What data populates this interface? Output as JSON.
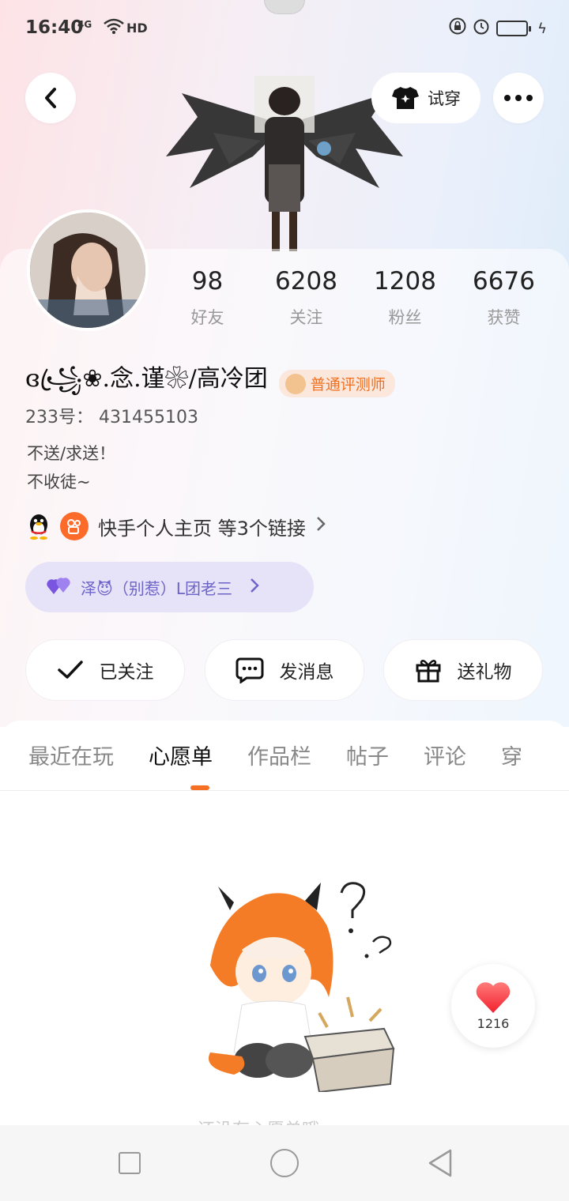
{
  "status_bar": {
    "time": "16:40",
    "network": "4G",
    "hd": "HD"
  },
  "header": {
    "try_on_label": "试穿"
  },
  "profile": {
    "stats": [
      {
        "value": "98",
        "label": "好友"
      },
      {
        "value": "6208",
        "label": "关注"
      },
      {
        "value": "1208",
        "label": "粉丝"
      },
      {
        "value": "6676",
        "label": "获赞"
      }
    ],
    "username": "ɞ꧁ꦿ❀.念.谨❀/高冷团",
    "badge_label": "普通评测师",
    "uid": "233号： 431455103",
    "bio_line1": "不送/求送！",
    "bio_line2": "不收徒~",
    "links_text": "快手个人主页 等3个链接",
    "cp_text": "泽😈（别惹）L团老三"
  },
  "actions": {
    "follow_label": "已关注",
    "message_label": "发消息",
    "gift_label": "送礼物"
  },
  "tabs": {
    "items": [
      "最近在玩",
      "心愿单",
      "作品栏",
      "帖子",
      "评论",
      "穿"
    ],
    "active_index": 1
  },
  "empty_state": {
    "text": "还没有心愿单哦"
  },
  "like_float": {
    "count": "1216"
  },
  "colors": {
    "accent": "#f57024",
    "badge_text": "#f0701f",
    "cp_pill_bg": "#e6e2f8",
    "heart": "#f5303e"
  }
}
